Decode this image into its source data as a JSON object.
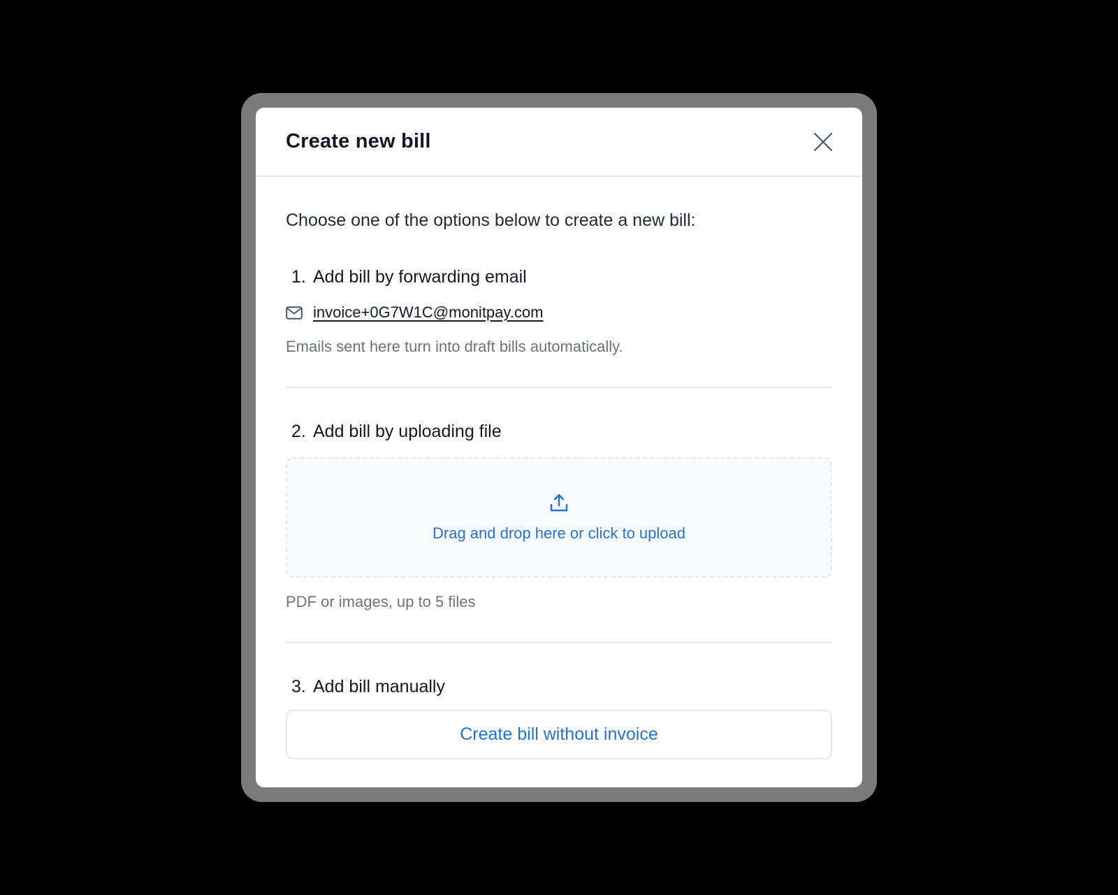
{
  "modal": {
    "title": "Create new bill",
    "close_icon": "close-x-icon",
    "intro": "Choose one of the options below to create a new bill:"
  },
  "option1": {
    "number": "1.",
    "title": "Add bill by forwarding email",
    "icon": "mail-icon",
    "email": "invoice+0G7W1C@monitpay.com",
    "hint": "Emails sent here turn into draft bills automatically."
  },
  "option2": {
    "number": "2.",
    "title": "Add bill by uploading file",
    "icon": "upload-icon",
    "dropzone_text": "Drag and drop here or click to upload",
    "hint": "PDF or images, up to 5 files"
  },
  "option3": {
    "number": "3.",
    "title": "Add bill manually",
    "button_label": "Create bill without invoice"
  },
  "colors": {
    "accent": "#2272d6",
    "title_text": "#111827",
    "muted_text": "#6b7280",
    "border": "#e5e7eb",
    "dropzone_bg": "#f9fafb"
  }
}
